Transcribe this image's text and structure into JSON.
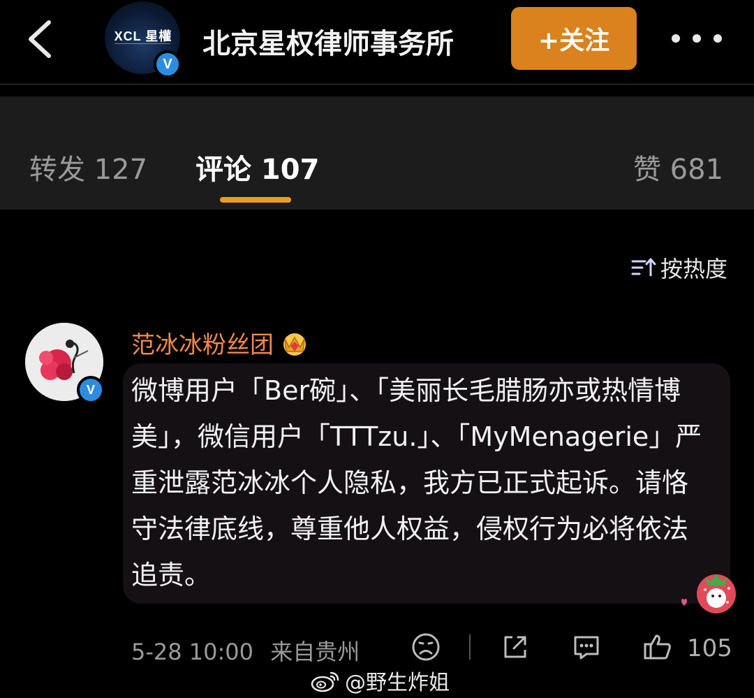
{
  "header": {
    "back_icon": "chevron-left-icon",
    "avatar_logo_text": "XCL 星權",
    "account_name": "北京星权律师事务所",
    "follow_label": "+关注",
    "verified_icon_label": "V",
    "more_icon": "more-dots-icon"
  },
  "tabs": [
    {
      "label": "转发 127",
      "active": false
    },
    {
      "label": "评论 107",
      "active": true
    },
    {
      "label": "赞 681",
      "active": false
    }
  ],
  "sort": {
    "label": "按热度",
    "icon": "sort-icon"
  },
  "comment": {
    "username": "范冰冰粉丝团",
    "verified_icon_label": "V",
    "text": "微博用户「Ber碗」、「美丽长毛腊肠亦或热情博美」，微信用户「TTTzu.」、「MyMenagerie」严重泄露范冰冰个人隐私，我方已正式起诉。请恪守法律底线，尊重他人权益，侵权行为必将依法追责。",
    "date": "5-28 10:00",
    "location": "来自贵州",
    "like_count": "105"
  },
  "watermark": {
    "text": "@野生炸姐",
    "icon": "weibo-logo-icon"
  },
  "colors": {
    "background": "#000000",
    "tab_bar": "#1c1c1c",
    "accent_orange": "#d9821e",
    "indicator": "#f29a1f",
    "username": "#f0894a",
    "verify_blue": "#2c8de0"
  }
}
